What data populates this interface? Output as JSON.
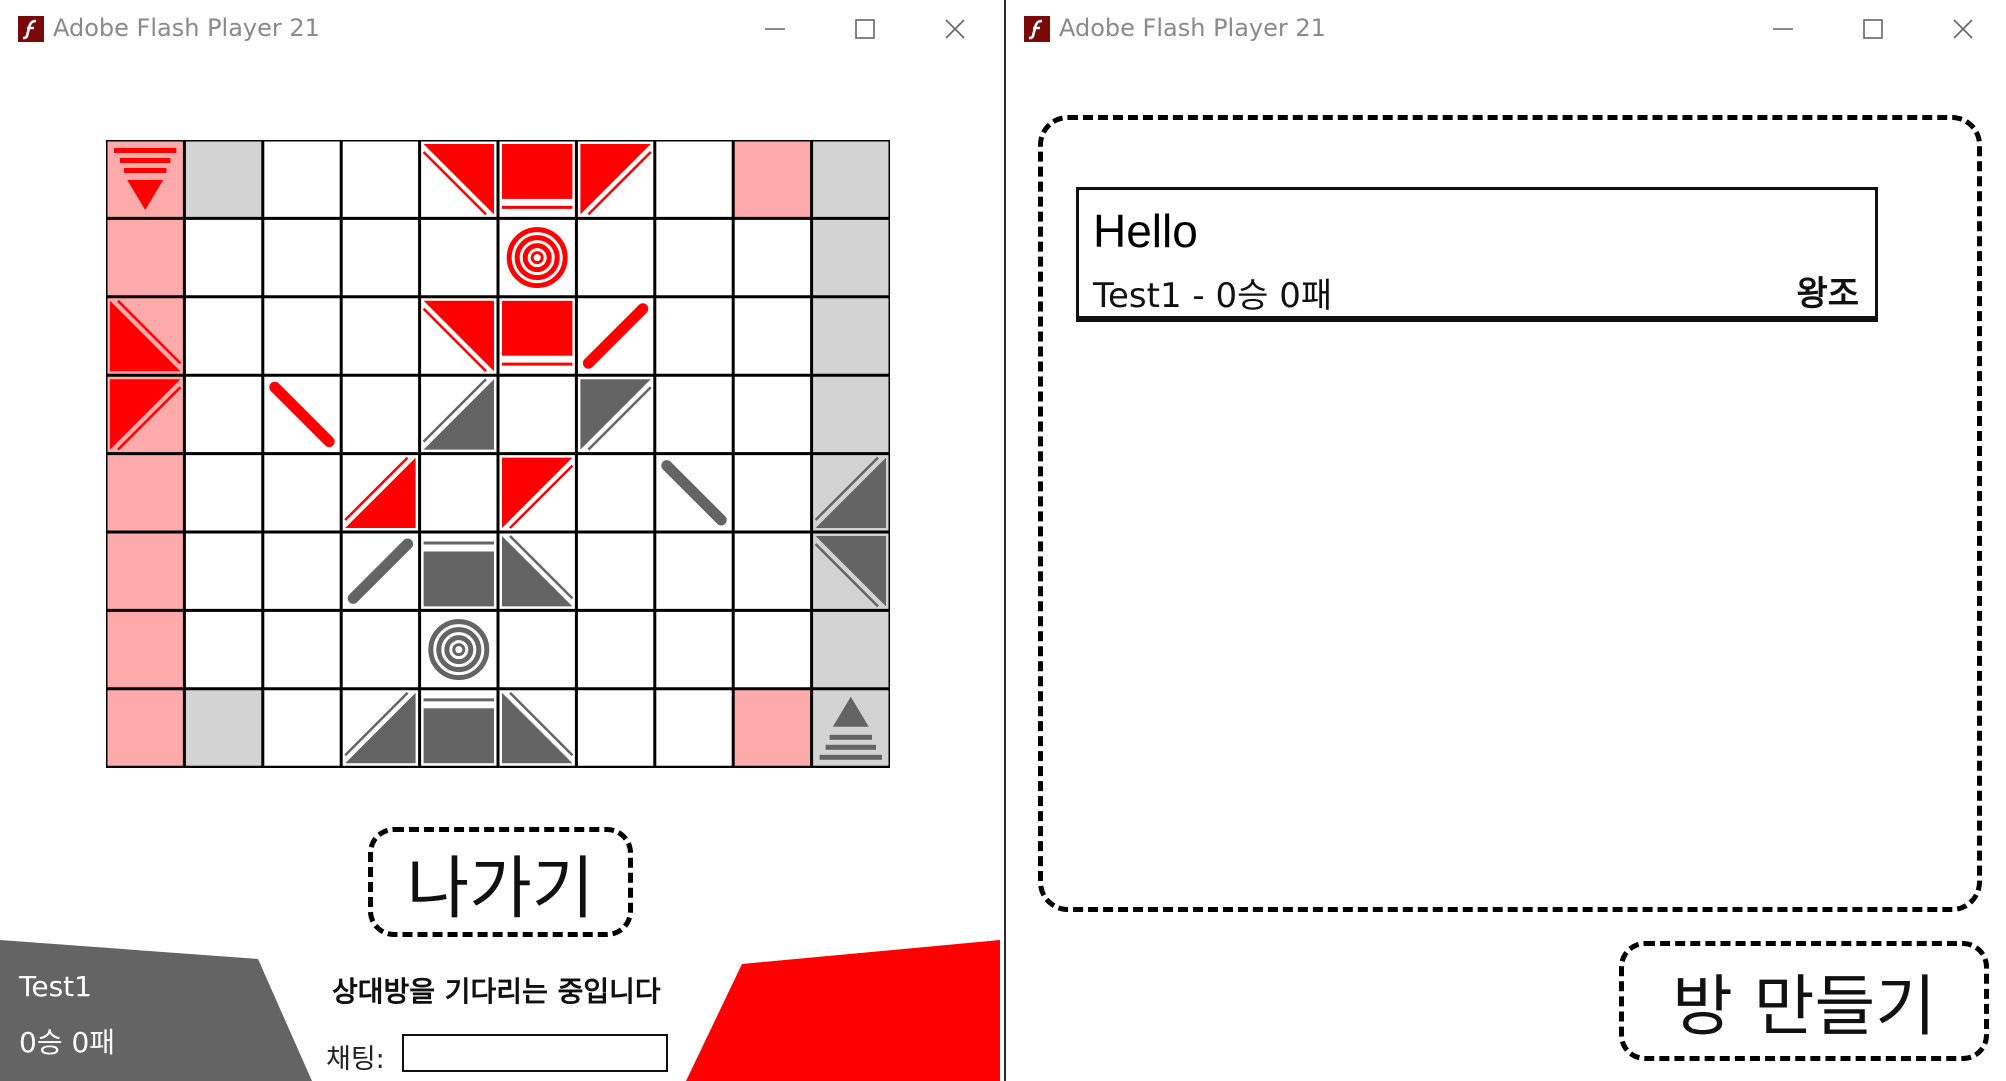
{
  "colors": {
    "red": "#ff0000",
    "light_red": "#ffaaaa",
    "gray": "#646464",
    "light_gray": "#d3d3d3",
    "panel_gray": "#646464",
    "flash_logo": "#7a0a0a"
  },
  "windows": {
    "left": {
      "title": "Adobe Flash Player 21",
      "icons": {
        "logo": "flash-player-logo",
        "minimize": "minimize-icon",
        "maximize": "maximize-icon",
        "close": "close-icon"
      }
    },
    "right": {
      "title": "Adobe Flash Player 21",
      "icons": {
        "logo": "flash-player-logo",
        "minimize": "minimize-icon",
        "maximize": "maximize-icon",
        "close": "close-icon"
      }
    }
  },
  "game": {
    "board": {
      "rows": 8,
      "cols": 10,
      "cell_fills": [
        [
          "light_red",
          "light_gray",
          "white",
          "white",
          "white",
          "white",
          "white",
          "white",
          "light_red",
          "light_gray"
        ],
        [
          "light_red",
          "white",
          "white",
          "white",
          "white",
          "white",
          "white",
          "white",
          "white",
          "light_gray"
        ],
        [
          "light_red",
          "white",
          "white",
          "white",
          "white",
          "white",
          "white",
          "white",
          "white",
          "light_gray"
        ],
        [
          "light_red",
          "white",
          "white",
          "white",
          "white",
          "white",
          "white",
          "white",
          "white",
          "light_gray"
        ],
        [
          "light_red",
          "white",
          "white",
          "white",
          "white",
          "white",
          "white",
          "white",
          "white",
          "light_gray"
        ],
        [
          "light_red",
          "white",
          "white",
          "white",
          "white",
          "white",
          "white",
          "white",
          "white",
          "light_gray"
        ],
        [
          "light_red",
          "white",
          "white",
          "white",
          "white",
          "white",
          "white",
          "white",
          "white",
          "light_gray"
        ],
        [
          "light_red",
          "light_gray",
          "white",
          "white",
          "white",
          "white",
          "white",
          "white",
          "light_red",
          "light_gray"
        ]
      ],
      "pieces": [
        {
          "row": 0,
          "col": 0,
          "team": "red",
          "kind": "laser-down"
        },
        {
          "row": 0,
          "col": 4,
          "team": "red",
          "kind": "tri-tr"
        },
        {
          "row": 0,
          "col": 5,
          "team": "red",
          "kind": "block-top"
        },
        {
          "row": 0,
          "col": 6,
          "team": "red",
          "kind": "tri-tl"
        },
        {
          "row": 1,
          "col": 5,
          "team": "red",
          "kind": "target"
        },
        {
          "row": 2,
          "col": 0,
          "team": "red",
          "kind": "tri-bl"
        },
        {
          "row": 2,
          "col": 4,
          "team": "red",
          "kind": "tri-tr"
        },
        {
          "row": 2,
          "col": 5,
          "team": "red",
          "kind": "block-top"
        },
        {
          "row": 2,
          "col": 6,
          "team": "red",
          "kind": "bar-slash"
        },
        {
          "row": 3,
          "col": 0,
          "team": "red",
          "kind": "tri-tl"
        },
        {
          "row": 3,
          "col": 2,
          "team": "red",
          "kind": "bar-backslash"
        },
        {
          "row": 3,
          "col": 4,
          "team": "gray",
          "kind": "tri-br"
        },
        {
          "row": 3,
          "col": 6,
          "team": "gray",
          "kind": "tri-tl"
        },
        {
          "row": 4,
          "col": 3,
          "team": "red",
          "kind": "tri-br"
        },
        {
          "row": 4,
          "col": 5,
          "team": "red",
          "kind": "tri-tl"
        },
        {
          "row": 4,
          "col": 7,
          "team": "gray",
          "kind": "bar-backslash"
        },
        {
          "row": 4,
          "col": 9,
          "team": "gray",
          "kind": "tri-br"
        },
        {
          "row": 5,
          "col": 3,
          "team": "gray",
          "kind": "bar-slash"
        },
        {
          "row": 5,
          "col": 4,
          "team": "gray",
          "kind": "block-bottom"
        },
        {
          "row": 5,
          "col": 5,
          "team": "gray",
          "kind": "tri-bl"
        },
        {
          "row": 5,
          "col": 9,
          "team": "gray",
          "kind": "tri-tr"
        },
        {
          "row": 6,
          "col": 4,
          "team": "gray",
          "kind": "target"
        },
        {
          "row": 7,
          "col": 3,
          "team": "gray",
          "kind": "tri-br"
        },
        {
          "row": 7,
          "col": 4,
          "team": "gray",
          "kind": "block-bottom"
        },
        {
          "row": 7,
          "col": 5,
          "team": "gray",
          "kind": "tri-bl"
        },
        {
          "row": 7,
          "col": 9,
          "team": "gray",
          "kind": "laser-up"
        }
      ]
    },
    "exit_button": "나가기",
    "status": "상대방을 기다리는 중입니다",
    "chat_label": "채팅:",
    "chat_value": "",
    "player": {
      "name": "Test1",
      "record": "0승 0패"
    }
  },
  "lobby": {
    "rooms": [
      {
        "title": "Hello",
        "host": "Test1 - 0승 0패",
        "team": "왕조"
      }
    ],
    "create_button": "방 만들기"
  }
}
